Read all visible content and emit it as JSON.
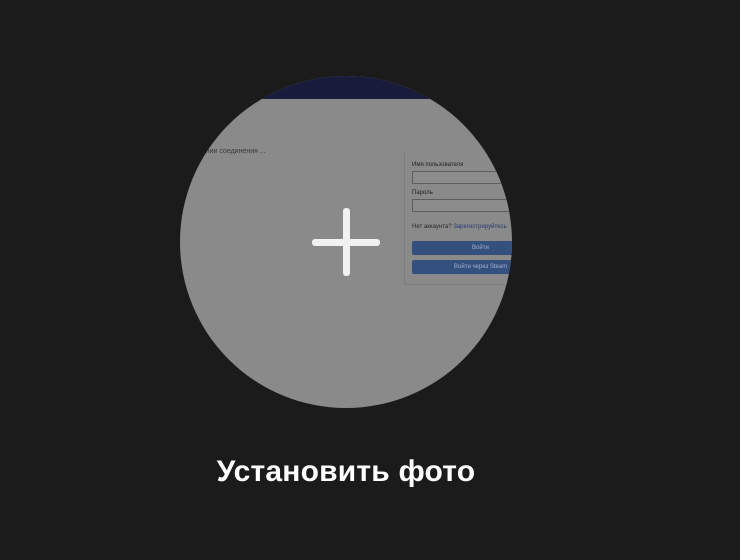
{
  "action": {
    "label": "Установить фото",
    "icon": "plus-icon"
  },
  "preview": {
    "left_text": "...ании соединения ...",
    "username_label": "Имя пользователя",
    "password_label": "Пароль",
    "hint_text": "Нет аккаунта? ",
    "hint_link": "Зарегистрируйтесь",
    "login_button": "Войти",
    "alt_login_button": "Войти через Steam"
  },
  "colors": {
    "background": "#1b1b1b",
    "circle": "#8a8a8a",
    "accent": "#34507f",
    "label": "#ffffff"
  }
}
